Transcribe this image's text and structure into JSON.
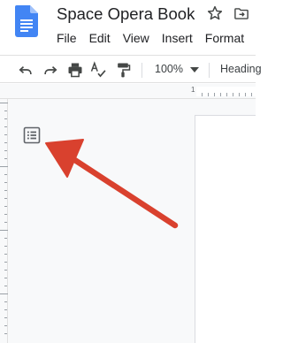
{
  "app": {
    "title": "Space Opera Book",
    "logo": "google-docs-logo-icon",
    "brand_color": "#4285f4"
  },
  "title_icons": [
    "star-icon",
    "move-to-folder-icon"
  ],
  "menu": {
    "items": [
      "File",
      "Edit",
      "View",
      "Insert",
      "Format"
    ]
  },
  "toolbar": {
    "icons": [
      "undo-icon",
      "redo-icon",
      "print-icon",
      "spellcheck-icon",
      "paint-format-icon"
    ],
    "zoom": "100%",
    "paragraph_style": "Heading"
  },
  "ruler": {
    "label": "1"
  },
  "sidebar": {
    "outline_icon": "document-outline-icon"
  },
  "annotation": {
    "type": "arrow",
    "color": "#d9412e"
  }
}
